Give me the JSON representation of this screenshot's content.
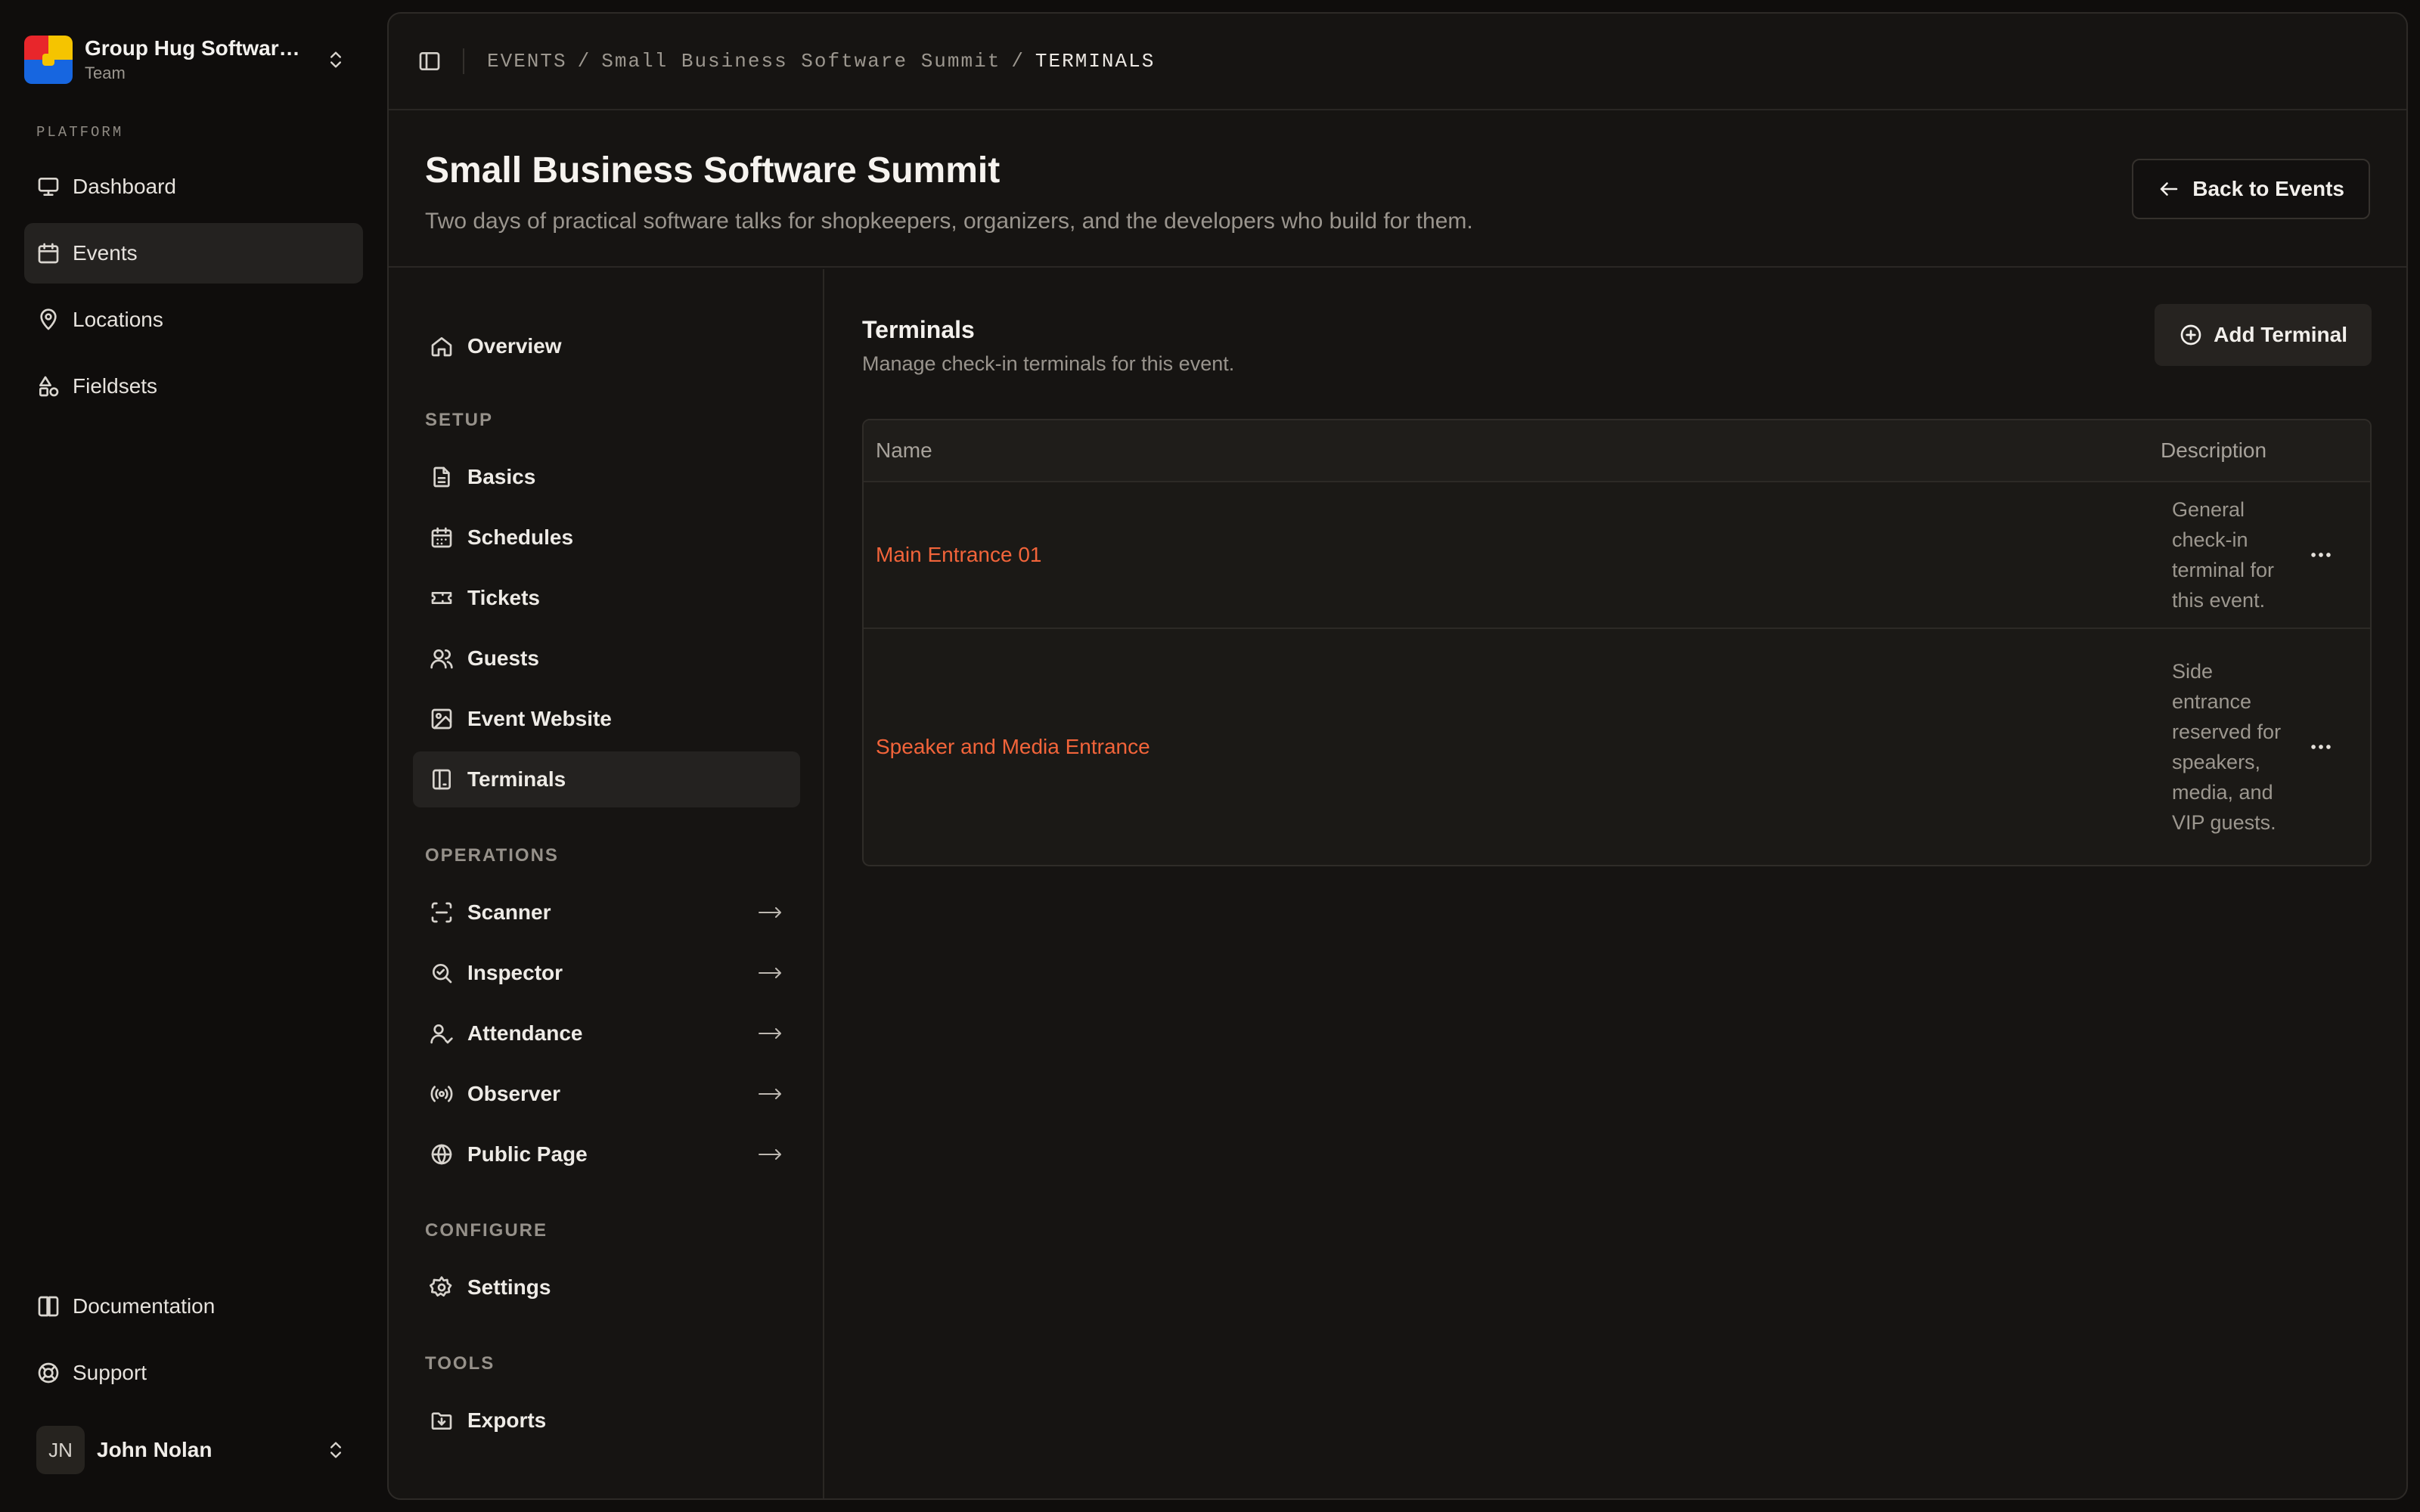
{
  "team": {
    "name": "Group Hug Software...",
    "plan": "Team"
  },
  "sidebar": {
    "group_label": "PLATFORM",
    "items": [
      {
        "label": "Dashboard",
        "icon": "monitor-icon"
      },
      {
        "label": "Events",
        "icon": "calendar-icon",
        "active": true
      },
      {
        "label": "Locations",
        "icon": "map-pin-icon"
      },
      {
        "label": "Fieldsets",
        "icon": "shapes-icon"
      }
    ],
    "footer_items": [
      {
        "label": "Documentation",
        "icon": "book-icon"
      },
      {
        "label": "Support",
        "icon": "life-buoy-icon"
      }
    ]
  },
  "user": {
    "initials": "JN",
    "name": "John Nolan"
  },
  "breadcrumb": {
    "items": [
      "EVENTS",
      "Small Business Software Summit",
      "TERMINALS"
    ],
    "separator": "/"
  },
  "page": {
    "title": "Small Business Software Summit",
    "subtitle": "Two days of practical software talks for shopkeepers, organizers, and the developers who build for them.",
    "back_label": "Back to Events"
  },
  "event_nav": {
    "overview": "Overview",
    "setup_label": "SETUP",
    "setup": [
      "Basics",
      "Schedules",
      "Tickets",
      "Guests",
      "Event Website",
      "Terminals"
    ],
    "operations_label": "OPERATIONS",
    "operations": [
      "Scanner",
      "Inspector",
      "Attendance",
      "Observer",
      "Public Page"
    ],
    "configure_label": "CONFIGURE",
    "configure": [
      "Settings"
    ],
    "tools_label": "TOOLS",
    "tools": [
      "Exports"
    ],
    "active": "Terminals"
  },
  "terminals": {
    "title": "Terminals",
    "description": "Manage check-in terminals for this event.",
    "add_label": "Add Terminal",
    "columns": [
      "Name",
      "Description"
    ],
    "rows": [
      {
        "name": "Main Entrance 01",
        "description": "General check-in terminal for this event."
      },
      {
        "name": "Speaker and Media Entrance",
        "description": "Side entrance reserved for speakers, media, and VIP guests."
      }
    ]
  },
  "colors": {
    "accent_link": "#f2643a",
    "background": "#0f0d0c",
    "panel": "#161412"
  }
}
